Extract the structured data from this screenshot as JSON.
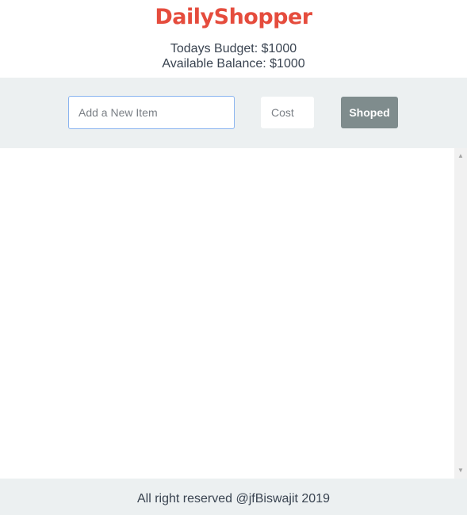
{
  "header": {
    "logo": "DailyShopper",
    "budget_label": "Todays Budget: $1000",
    "balance_label": "Available Balance: $1000"
  },
  "form": {
    "item_placeholder": "Add a New Item",
    "cost_placeholder": "Cost",
    "submit_label": "Shoped"
  },
  "list": {
    "items": []
  },
  "footer": {
    "text": "All right reserved @jfBiswajit 2019"
  },
  "colors": {
    "brand": "#e54c3d",
    "bar_bg": "#ecf0f1",
    "button_bg": "#7f8c8d",
    "focus_border": "#8ab4f0"
  }
}
